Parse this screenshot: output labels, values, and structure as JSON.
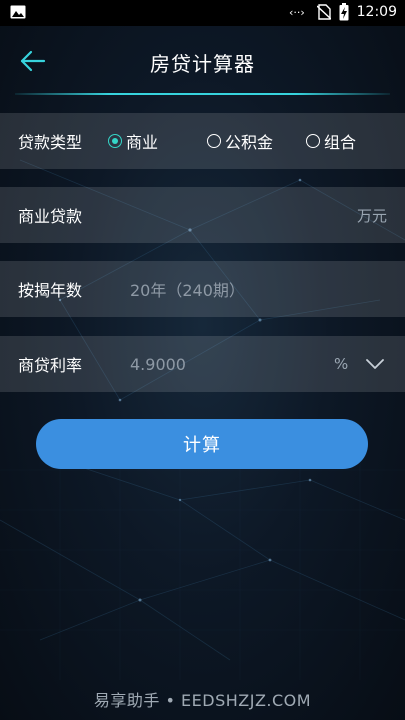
{
  "status_bar": {
    "time": "12:09",
    "icons": [
      "image-icon",
      "signal-icon",
      "no-sim-icon",
      "battery-charging-icon"
    ]
  },
  "app_bar": {
    "title": "房贷计算器",
    "back_icon": "arrow-left-icon",
    "accent_color": "#37d3dd"
  },
  "form": {
    "loan_type": {
      "label": "贷款类型",
      "options": [
        {
          "label": "商业",
          "selected": true
        },
        {
          "label": "公积金",
          "selected": false
        },
        {
          "label": "组合",
          "selected": false
        }
      ]
    },
    "commercial_loan": {
      "label": "商业贷款",
      "value": "",
      "unit": "万元"
    },
    "term": {
      "label": "按揭年数",
      "value": "20年（240期）"
    },
    "rate": {
      "label": "商贷利率",
      "value": "4.9000",
      "unit": "%",
      "dropdown_icon": "chevron-down-icon"
    }
  },
  "action": {
    "calculate_label": "计算",
    "button_color": "#3b8fe0"
  },
  "watermark": "易享助手 • EEDSHZJZ.COM"
}
